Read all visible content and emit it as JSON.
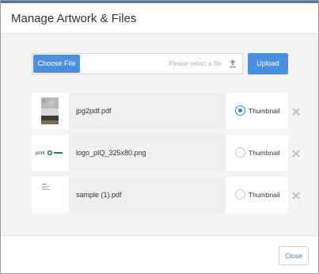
{
  "dialog": {
    "title": "Manage Artwork & Files"
  },
  "uploader": {
    "choose_label": "Choose File",
    "placeholder": "Please select a file",
    "upload_label": "Upload"
  },
  "files": [
    {
      "name": "jpg2pdf.pdf",
      "thumbnail_label": "Thumbnail",
      "selected": true
    },
    {
      "name": "logo_pIQ_325x80.png",
      "thumbnail_label": "Thumbnail",
      "selected": false
    },
    {
      "name": "sample (1).pdf",
      "thumbnail_label": "Thumbnail",
      "selected": false
    }
  ],
  "logo_text": "print",
  "footer": {
    "close_label": "Close"
  },
  "colors": {
    "accent": "#4a8fe0",
    "radio_selected": "#3a7fd6"
  }
}
